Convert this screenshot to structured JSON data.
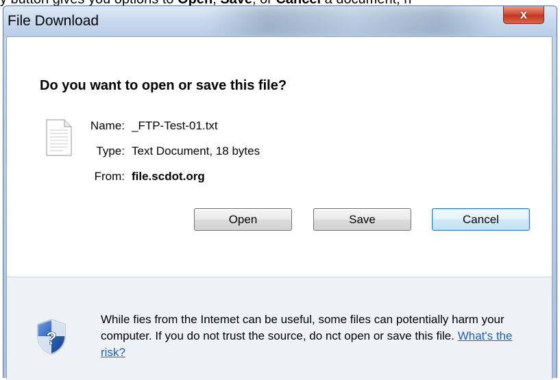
{
  "background_text": {
    "part1": "y button gives you options to ",
    "open": "Open",
    "sep1": ", ",
    "save": "Save",
    "sep2": ", or ",
    "cancel": "Cancel",
    "part2": " a document, n"
  },
  "window": {
    "title": "File Download",
    "close_glyph": "x"
  },
  "dialog": {
    "heading": "Do you want to open or save this file?",
    "file_icon": "text-document-icon",
    "fields": {
      "name_label": "Name:",
      "name_value": "_FTP-Test-01.txt",
      "type_label": "Type:",
      "type_value": "Text Document, 18 bytes",
      "from_label": "From:",
      "from_value": "file.scdot.org"
    },
    "buttons": {
      "open": "Open",
      "save": "Save",
      "cancel": "Cancel"
    }
  },
  "footer": {
    "icon": "security-shield-question-icon",
    "warning": "While fies from the Intemet can be useful, some files can potentially harm your computer. If you do not trust the source, do nct open or save this file.",
    "link": "What's the risk?"
  },
  "colors": {
    "link": "#1a5fb4",
    "close_button": "#c2381f",
    "footer_bg": "#eef1f6"
  }
}
